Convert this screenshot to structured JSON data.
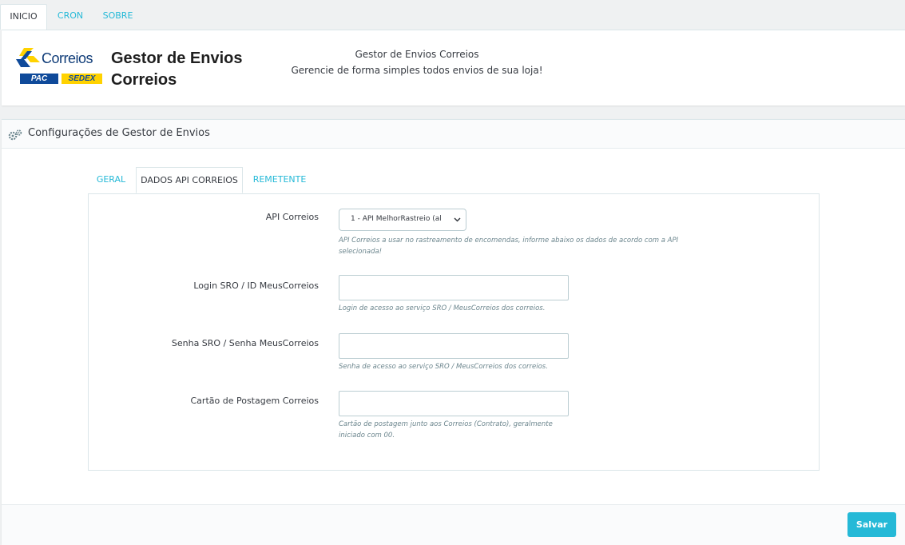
{
  "top_tabs": [
    {
      "label": "INICIO",
      "active": true
    },
    {
      "label": "CRON",
      "active": false
    },
    {
      "label": "SOBRE",
      "active": false
    }
  ],
  "header": {
    "logo_word": "Correios",
    "logo_pac": "PAC",
    "logo_sedex": "SEDEX",
    "title": "Gestor de Envios Correios",
    "subtitle_line1": "Gestor de Envios Correios",
    "subtitle_line2": "Gerencie de forma simples todos envios de sua loja!"
  },
  "config": {
    "heading": "Configurações de Gestor de Envios",
    "heading_icon": "gears-icon",
    "tabs": [
      {
        "label": "GERAL",
        "active": false
      },
      {
        "label": "DADOS API CORREIOS",
        "active": true
      },
      {
        "label": "REMETENTE",
        "active": false
      }
    ],
    "fields": [
      {
        "label": "API Correios",
        "type": "select",
        "value": "1 - API MelhorRastreio (al",
        "help": "API Correios a usar no rastreamento de encomendas, informe abaixo os dados de acordo com a API selecionada!"
      },
      {
        "label": "Login SRO / ID MeusCorreios",
        "type": "text",
        "value": "",
        "help": "Login de acesso ao serviço SRO / MeusCorreios dos correios."
      },
      {
        "label": "Senha SRO / Senha MeusCorreios",
        "type": "text",
        "value": "",
        "help": "Senha de acesso ao serviço SRO / MeusCorreios dos correios."
      },
      {
        "label": "Cartão de Postagem Correios",
        "type": "text",
        "value": "",
        "help": "Cartão de postagem junto aos Correios (Contrato), geralmente iniciado com 00."
      }
    ],
    "save_label": "Salvar"
  },
  "colors": {
    "accent": "#25b9d7",
    "text": "#363a41",
    "border": "#bbcdd2",
    "background": "#eff1f2"
  }
}
